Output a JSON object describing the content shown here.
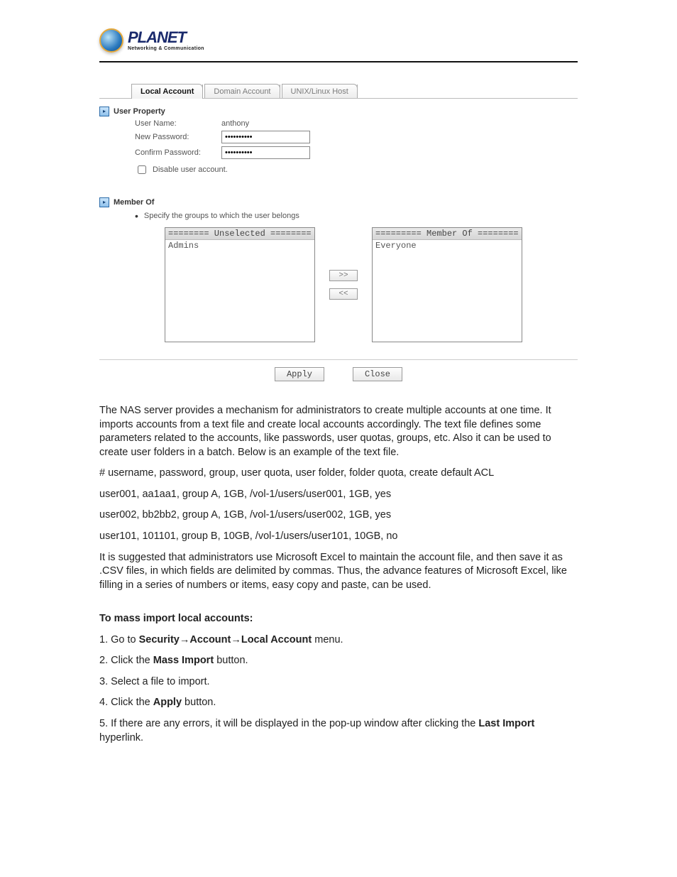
{
  "logo": {
    "brand": "PLANET",
    "tagline": "Networking & Communication"
  },
  "tabs": {
    "local": "Local Account",
    "domain": "Domain Account",
    "unix": "UNIX/Linux Host"
  },
  "userProperty": {
    "heading": "User Property",
    "userNameLabel": "User Name:",
    "userNameValue": "anthony",
    "newPasswordLabel": "New Password:",
    "newPasswordValue": "••••••••••",
    "confirmPasswordLabel": "Confirm Password:",
    "confirmPasswordValue": "••••••••••",
    "disableLabel": "Disable user account."
  },
  "memberOf": {
    "heading": "Member Of",
    "specify": "Specify the groups to which the user belongs",
    "unselectedHeader": "======== Unselected ========",
    "unselectedItems": [
      "Admins"
    ],
    "memberHeader": "========= Member Of ========",
    "memberItems": [
      "Everyone"
    ],
    "addBtn": ">>",
    "removeBtn": "<<"
  },
  "actions": {
    "apply": "Apply",
    "close": "Close"
  },
  "doc": {
    "p1": "The NAS server provides a mechanism for administrators to create multiple accounts at one time. It imports accounts from a text file and create local accounts accordingly. The text file defines some parameters related to the accounts, like passwords, user quotas, groups, etc. Also it can be used to create user folders in a batch. Below is an example of the text file.",
    "p2": "# username, password, group, user quota, user folder, folder quota, create default ACL",
    "p3": "user001, aa1aa1, group A, 1GB, /vol-1/users/user001, 1GB, yes",
    "p4": "user002, bb2bb2, group A, 1GB, /vol-1/users/user002, 1GB, yes",
    "p5": "user101, 101101, group B, 10GB, /vol-1/users/user101, 10GB, no",
    "p6": "It is suggested that administrators use Microsoft Excel to maintain the account file, and then save it as .CSV files, in which fields are delimited by commas. Thus, the advance features of Microsoft Excel, like filling in a series of numbers or items, easy copy and paste, can be used.",
    "h1": "To mass import local accounts:",
    "s1a": "1. Go to ",
    "s1b": "Security→Account→Local Account",
    "s1c": " menu.",
    "s2a": "2. Click the ",
    "s2b": "Mass Import",
    "s2c": " button.",
    "s3": "3. Select a file to import.",
    "s4a": "4. Click the ",
    "s4b": "Apply",
    "s4c": " button.",
    "s5a": "5. If there are any errors, it will be displayed in the pop-up window after clicking the ",
    "s5b": "Last Import",
    "s5c": " hyperlink."
  }
}
